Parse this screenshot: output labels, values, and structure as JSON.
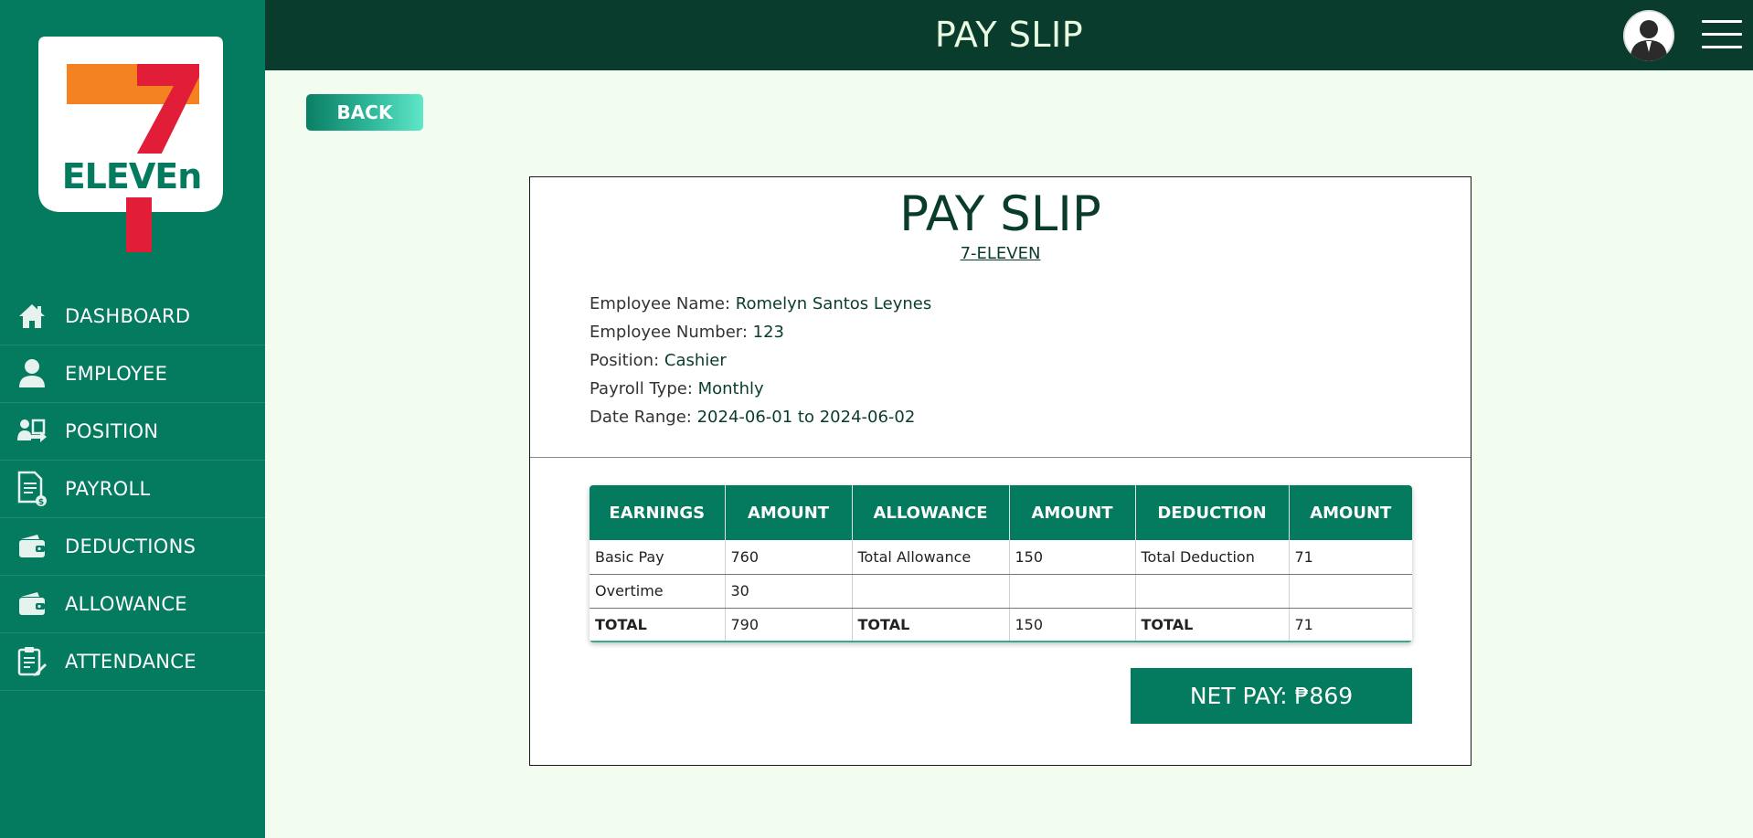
{
  "app": {
    "brand_logo_alt": "7-ELEVEN"
  },
  "colors": {
    "sidebar": "#047a5e",
    "header": "#0a3c2d",
    "background": "#f3fdef",
    "accent": "#047a5e"
  },
  "header": {
    "title": "PAY SLIP",
    "avatar_icon": "user-avatar-icon",
    "menu_icon": "hamburger-menu-icon"
  },
  "sidebar": {
    "items": [
      {
        "label": "DASHBOARD",
        "icon": "home-icon"
      },
      {
        "label": "EMPLOYEE",
        "icon": "user-icon"
      },
      {
        "label": "POSITION",
        "icon": "position-icon"
      },
      {
        "label": "PAYROLL",
        "icon": "payroll-document-icon"
      },
      {
        "label": "DEDUCTIONS",
        "icon": "wallet-icon"
      },
      {
        "label": "ALLOWANCE",
        "icon": "wallet-icon"
      },
      {
        "label": "ATTENDANCE",
        "icon": "clipboard-edit-icon"
      }
    ]
  },
  "back_button": {
    "label": "BACK"
  },
  "slip": {
    "title": "PAY SLIP",
    "company": "7-ELEVEN",
    "info": [
      {
        "label": "Employee Name: ",
        "value": "Romelyn Santos Leynes"
      },
      {
        "label": "Employee Number: ",
        "value": "123"
      },
      {
        "label": "Position: ",
        "value": "Cashier"
      },
      {
        "label": "Payroll Type: ",
        "value": "Monthly"
      },
      {
        "label": "Date Range: ",
        "value": "2024-06-01 to 2024-06-02"
      }
    ],
    "table": {
      "headers": [
        "EARNINGS",
        "AMOUNT",
        "ALLOWANCE",
        "AMOUNT",
        "DEDUCTION",
        "AMOUNT"
      ],
      "rows": [
        [
          "Basic Pay",
          "760",
          "Total Allowance",
          "150",
          "Total Deduction",
          "71"
        ],
        [
          "Overtime",
          "30",
          "",
          "",
          "",
          ""
        ]
      ],
      "totals": [
        "TOTAL",
        "790",
        "TOTAL",
        "150",
        "TOTAL",
        "71"
      ]
    },
    "net_pay": "NET PAY: ₱869"
  }
}
